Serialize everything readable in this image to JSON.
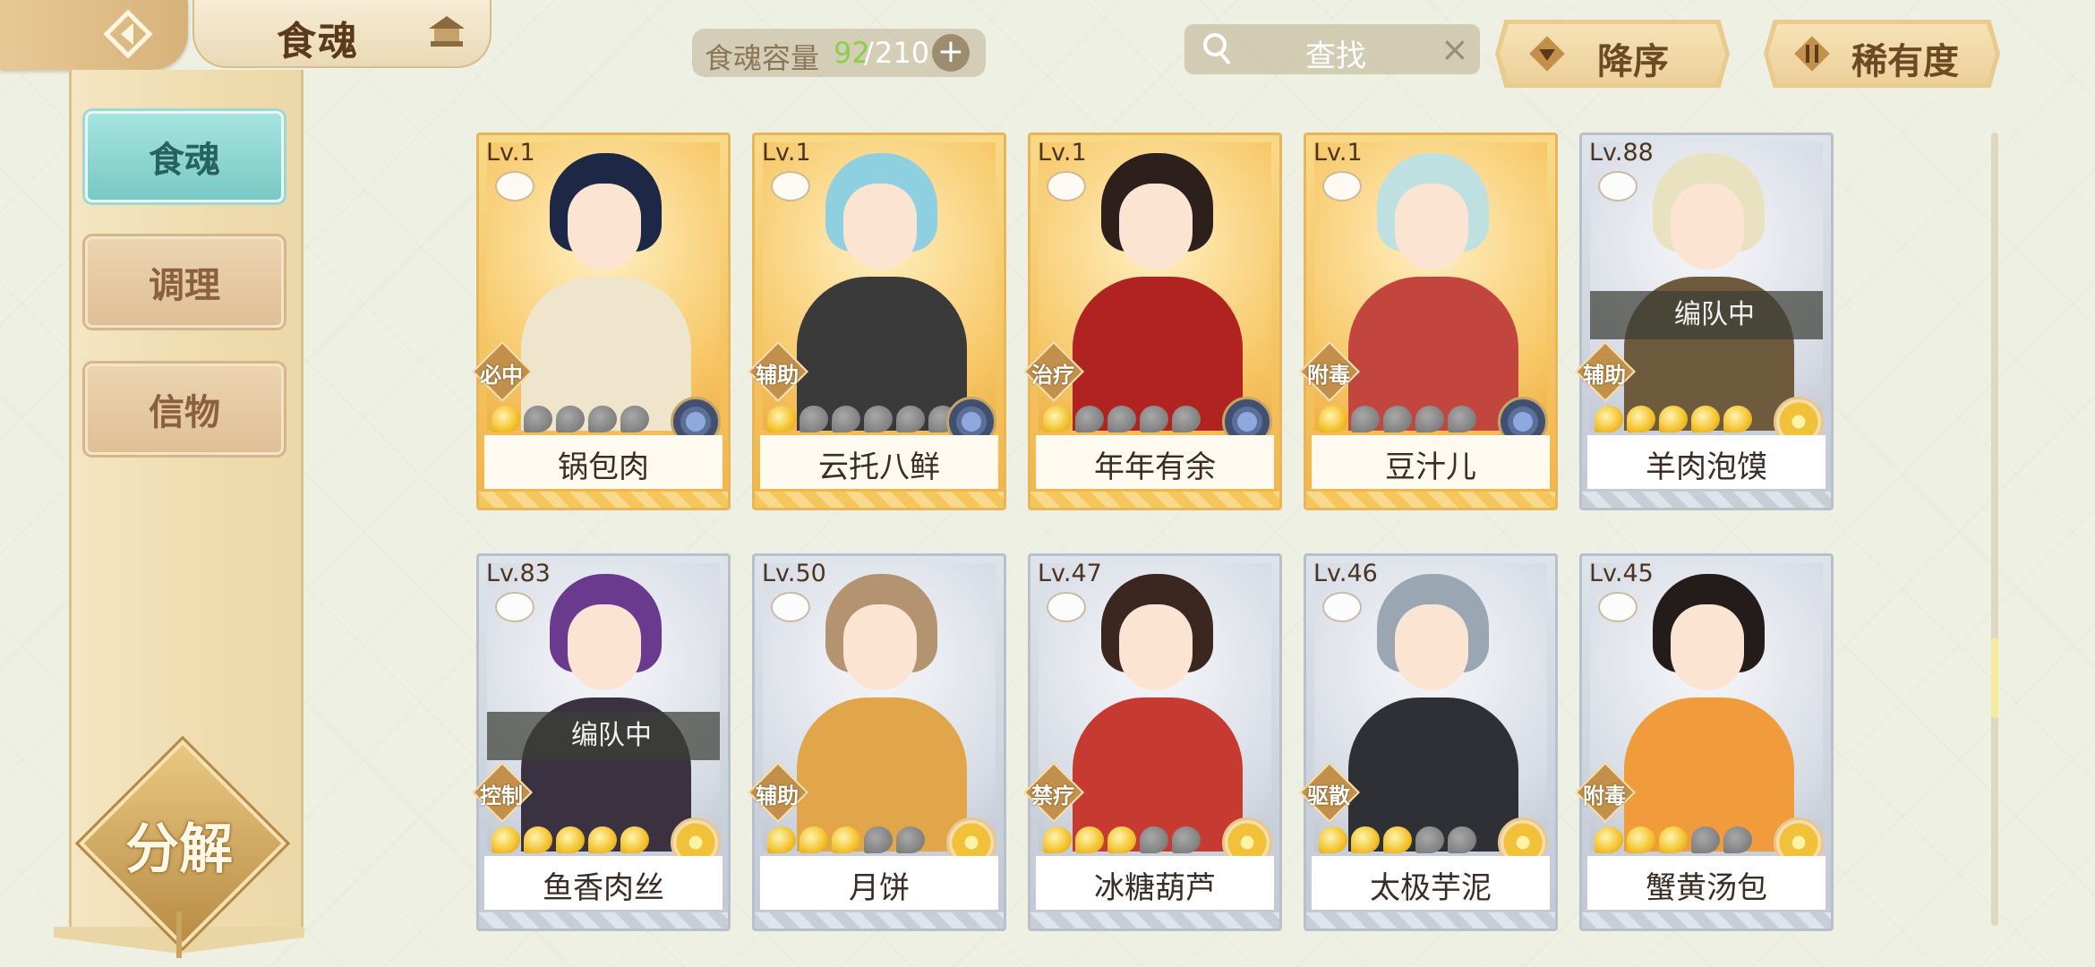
{
  "header": {
    "title": "食魂",
    "capacity": {
      "label": "食魂容量",
      "current": "92",
      "separator": "/",
      "max": "210",
      "plus": "+"
    },
    "search": {
      "placeholder": "查找",
      "clear": "×"
    },
    "sort_label": "降序",
    "rarity_label": "稀有度"
  },
  "sidebar": {
    "tabs": [
      {
        "label": "食魂",
        "active": true
      },
      {
        "label": "调理",
        "active": false
      },
      {
        "label": "信物",
        "active": false
      }
    ],
    "decompose_label": "分解"
  },
  "cards": [
    {
      "level": "Lv.1",
      "name": "锅包肉",
      "role": "必中",
      "stars": 5,
      "filled": 1,
      "frame": "gold",
      "element": "water",
      "hair": "#1d2746",
      "outfit": "#efe4cc",
      "team": ""
    },
    {
      "level": "Lv.1",
      "name": "云托八鲜",
      "role": "辅助",
      "stars": 6,
      "filled": 1,
      "frame": "gold",
      "element": "water",
      "hair": "#8fd0e0",
      "outfit": "#3a3a3a",
      "team": ""
    },
    {
      "level": "Lv.1",
      "name": "年年有余",
      "role": "治疗",
      "stars": 5,
      "filled": 1,
      "frame": "gold",
      "element": "water",
      "hair": "#2d1f1c",
      "outfit": "#b02320",
      "team": ""
    },
    {
      "level": "Lv.1",
      "name": "豆汁儿",
      "role": "附毒",
      "stars": 5,
      "filled": 1,
      "frame": "gold",
      "element": "water",
      "hair": "#bfe0e0",
      "outfit": "#c2453e",
      "team": ""
    },
    {
      "level": "Lv.88",
      "name": "羊肉泡馍",
      "role": "辅助",
      "stars": 5,
      "filled": 5,
      "frame": "silver",
      "element": "flower",
      "hair": "#e9e2c0",
      "outfit": "#6e5a3c",
      "team": "编队中"
    },
    {
      "level": "Lv.83",
      "name": "鱼香肉丝",
      "role": "控制",
      "stars": 5,
      "filled": 5,
      "frame": "silver",
      "element": "flower",
      "hair": "#6a3a8e",
      "outfit": "#3a3240",
      "team": "编队中"
    },
    {
      "level": "Lv.50",
      "name": "月饼",
      "role": "辅助",
      "stars": 5,
      "filled": 3,
      "frame": "silver",
      "element": "flower",
      "hair": "#b49470",
      "outfit": "#e1a54a",
      "team": ""
    },
    {
      "level": "Lv.47",
      "name": "冰糖葫芦",
      "role": "禁疗",
      "stars": 5,
      "filled": 3,
      "frame": "silver",
      "element": "flower",
      "hair": "#3b2720",
      "outfit": "#c63a32",
      "team": ""
    },
    {
      "level": "Lv.46",
      "name": "太极芋泥",
      "role": "驱散",
      "stars": 5,
      "filled": 3,
      "frame": "silver",
      "element": "flower",
      "hair": "#9aa7b2",
      "outfit": "#2f2f36",
      "team": ""
    },
    {
      "level": "Lv.45",
      "name": "蟹黄汤包",
      "role": "附毒",
      "stars": 5,
      "filled": 3,
      "frame": "silver",
      "element": "flower",
      "hair": "#231c1a",
      "outfit": "#f09c3c",
      "team": ""
    }
  ]
}
